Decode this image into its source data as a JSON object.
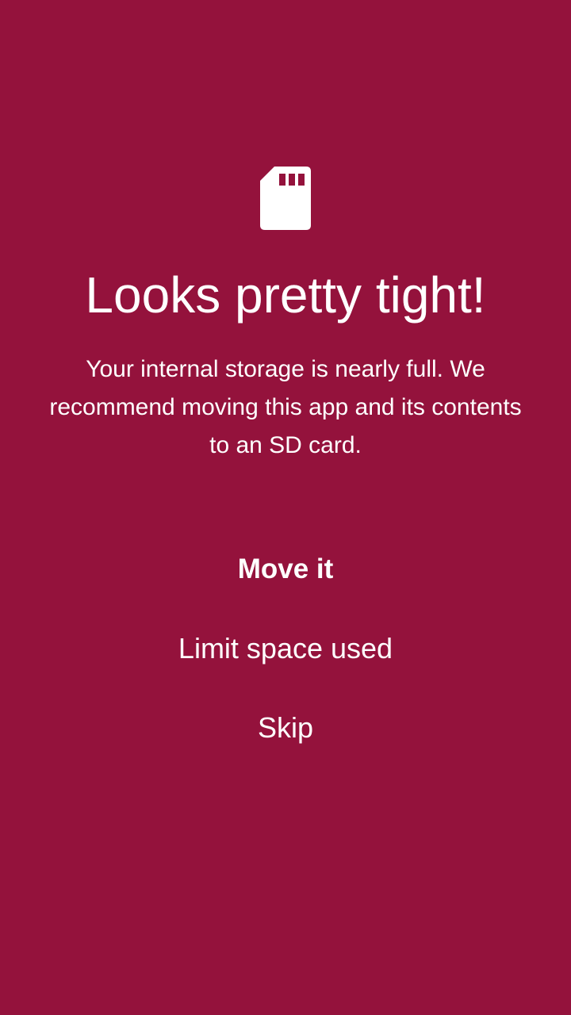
{
  "screen": {
    "background_color": "#94123C",
    "icon": "sd-card-icon",
    "title": "Looks pretty tight!",
    "message": "Your internal storage is nearly full. We recommend moving this app and its contents to an SD card."
  },
  "actions": {
    "primary": "Move it",
    "secondary": "Limit space used",
    "skip": "Skip"
  }
}
